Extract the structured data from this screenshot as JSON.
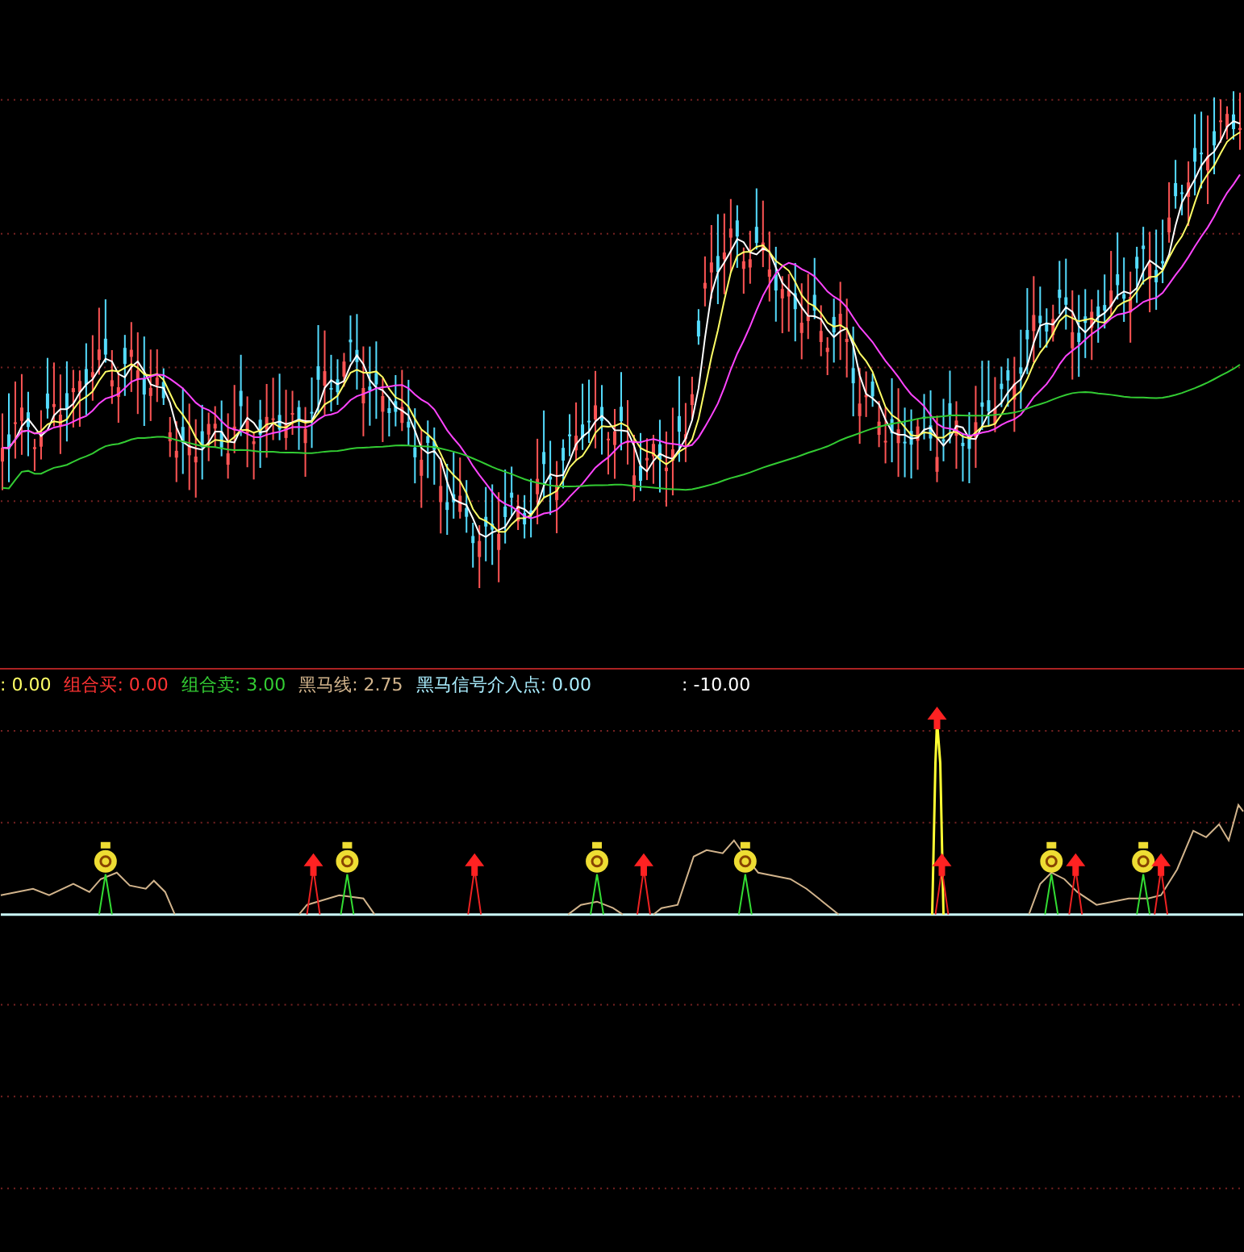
{
  "indicator_panel": {
    "legend": [
      {
        "text": ": 0.00",
        "color": "#ffff66"
      },
      {
        "text": "组合买: 0.00",
        "color": "#ff3333"
      },
      {
        "text": "组合卖: 3.00",
        "color": "#33cc33"
      },
      {
        "text": "黑马线: 2.75",
        "color": "#d2b48c"
      },
      {
        "text": "黑马信号介入点: 0.00",
        "color": "#aaeeff"
      },
      {
        "text": ": -10.00",
        "color": "#ffffff"
      }
    ]
  }
}
